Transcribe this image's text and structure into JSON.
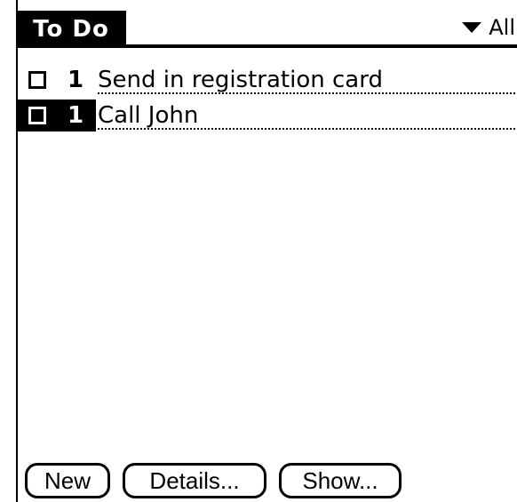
{
  "app": {
    "title": "To Do",
    "category": "All"
  },
  "todo_items": [
    {
      "priority": "1",
      "description": "Send in registration card",
      "selected": false
    },
    {
      "priority": "1",
      "description": "Call John",
      "selected": true
    }
  ],
  "buttons": {
    "new_label": "New",
    "details_label": "Details...",
    "show_label": "Show..."
  },
  "icons": {
    "category_dropdown": "triangle-down-icon",
    "checkbox": "empty-checkbox-icon"
  }
}
